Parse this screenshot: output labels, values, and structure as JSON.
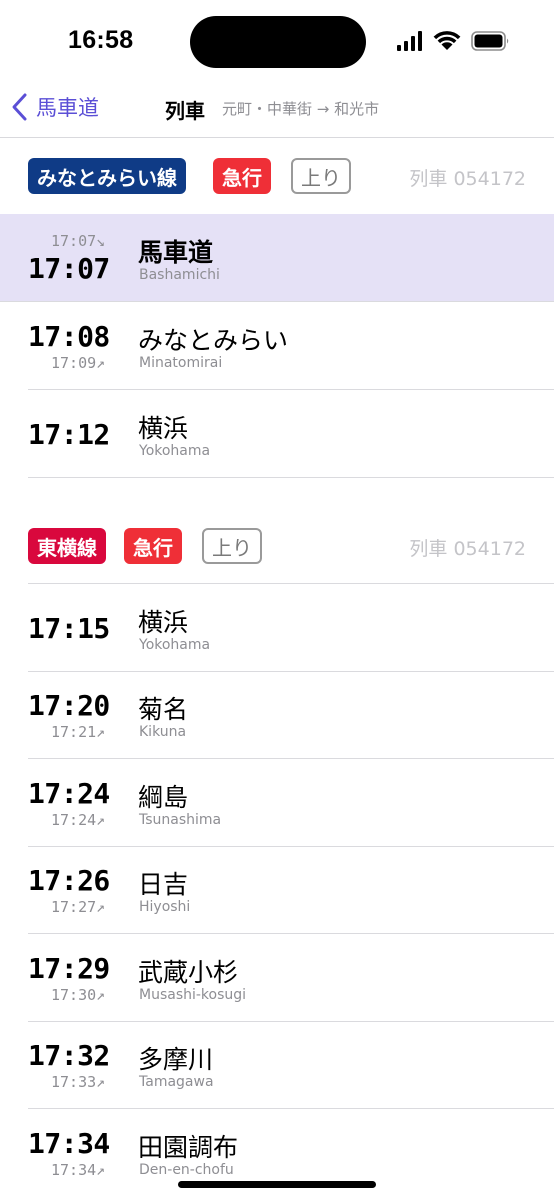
{
  "status_bar": {
    "time": "16:58"
  },
  "nav": {
    "back_label": "馬車道",
    "title": "列車",
    "subtitle": "元町・中華街 → 和光市"
  },
  "colors": {
    "accent": "#5b4fd6",
    "highlight_row": "#e5e1f6",
    "minatomirai_line": "#0f3b86",
    "toyoko_line": "#d9083d",
    "express": "#ef2f37"
  },
  "sections": [
    {
      "line": "みなとみらい線",
      "type": "急行",
      "direction": "上り",
      "train_no": "列車 054172",
      "stops": [
        {
          "time": "17:07",
          "sub_time": "17:07↘",
          "name_jp": "馬車道",
          "name_en": "Bashamichi"
        },
        {
          "time": "17:08",
          "sub_time": "17:09↗",
          "name_jp": "みなとみらい",
          "name_en": "Minatomirai"
        },
        {
          "time": "17:12",
          "sub_time": "",
          "name_jp": "横浜",
          "name_en": "Yokohama"
        }
      ]
    },
    {
      "line": "東横線",
      "type": "急行",
      "direction": "上り",
      "train_no": "列車 054172",
      "stops": [
        {
          "time": "17:15",
          "sub_time": "",
          "name_jp": "横浜",
          "name_en": "Yokohama"
        },
        {
          "time": "17:20",
          "sub_time": "17:21↗",
          "name_jp": "菊名",
          "name_en": "Kikuna"
        },
        {
          "time": "17:24",
          "sub_time": "17:24↗",
          "name_jp": "綱島",
          "name_en": "Tsunashima"
        },
        {
          "time": "17:26",
          "sub_time": "17:27↗",
          "name_jp": "日吉",
          "name_en": "Hiyoshi"
        },
        {
          "time": "17:29",
          "sub_time": "17:30↗",
          "name_jp": "武蔵小杉",
          "name_en": "Musashi-kosugi"
        },
        {
          "time": "17:32",
          "sub_time": "17:33↗",
          "name_jp": "多摩川",
          "name_en": "Tamagawa"
        },
        {
          "time": "17:34",
          "sub_time": "17:34↗",
          "name_jp": "田園調布",
          "name_en": "Den-en-chofu"
        }
      ]
    }
  ]
}
